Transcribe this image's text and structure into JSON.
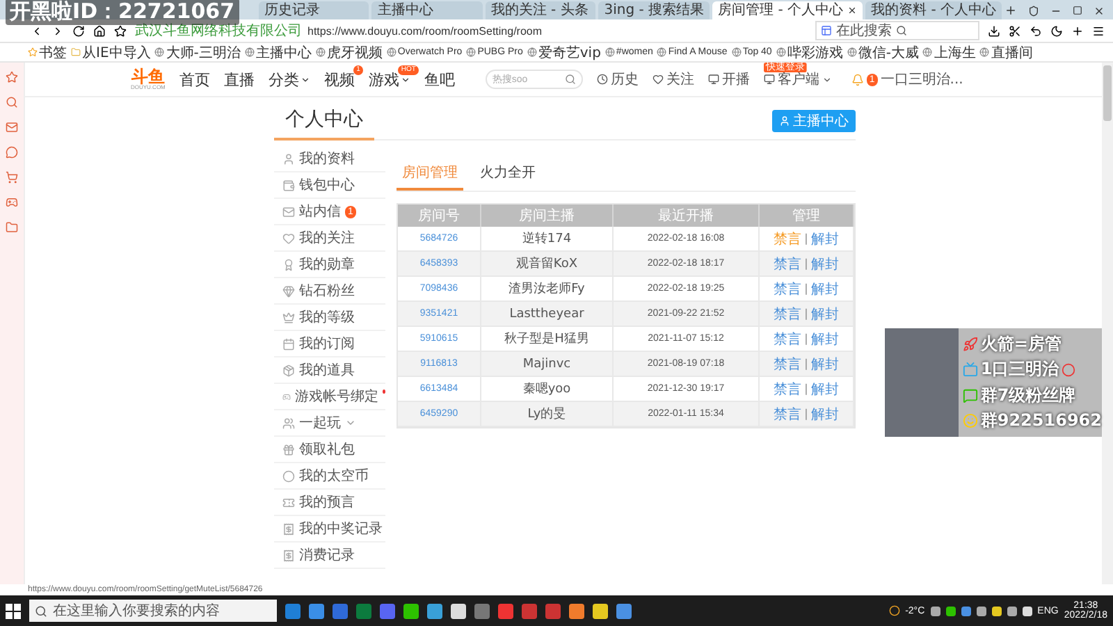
{
  "stream_overlay": {
    "caption": "开黑啦ID：22721067"
  },
  "browser": {
    "tabs": [
      {
        "title": "历史记录",
        "selected": false
      },
      {
        "title": "主播中心",
        "selected": false
      },
      {
        "title": "我的关注 - 头条",
        "selected": false
      },
      {
        "title": "3ing - 搜索结果",
        "selected": false
      },
      {
        "title": "房间管理 - 个人中心",
        "selected": true
      },
      {
        "title": "我的资料 - 个人中心",
        "selected": false
      }
    ],
    "address": {
      "cert": "武汉斗鱼网络科技有限公司",
      "url": "https://www.douyu.com/room/roomSetting/room"
    },
    "search": {
      "placeholder": "在此搜索"
    },
    "bookmarks": [
      "书签",
      "从IE中导入",
      "大师-三明治",
      "主播中心",
      "虎牙视频",
      "Overwatch Pro",
      "PUBG Pro",
      "爱奇艺vip",
      "#women",
      "Find A Mouse",
      "Top 40",
      "哔彩游戏",
      "微信-大威",
      "上海生",
      "直播间"
    ],
    "status_url": "https://www.douyu.com/room/roomSetting/getMuteList/5684726"
  },
  "site_header": {
    "logo": "斗鱼",
    "logo_sub": "DOUYU.COM",
    "nav": [
      {
        "label": "首页",
        "dropdown": false
      },
      {
        "label": "直播",
        "dropdown": false
      },
      {
        "label": "分类",
        "dropdown": true
      },
      {
        "label": "视频",
        "dropdown": false,
        "dot": "1"
      },
      {
        "label": "游戏",
        "dropdown": true,
        "tag": "HOT"
      },
      {
        "label": "鱼吧",
        "dropdown": false
      }
    ],
    "search": {
      "placeholder": "热搜soo"
    },
    "actions": [
      {
        "kind": "history",
        "label": "历史"
      },
      {
        "kind": "follow",
        "label": "关注"
      },
      {
        "kind": "live",
        "label": "开播"
      },
      {
        "kind": "client",
        "label": "客户端",
        "tag": "快速登录"
      }
    ],
    "user": {
      "name": "一口三明治...",
      "notifications": "1"
    }
  },
  "page": {
    "title": "个人中心",
    "anchor_button": "主播中心",
    "menu": [
      {
        "label": "我的资料",
        "kind": "link"
      },
      {
        "label": "钱包中心",
        "kind": "link"
      },
      {
        "label": "站内信",
        "kind": "link",
        "badge": "1"
      },
      {
        "label": "我的关注",
        "kind": "link"
      },
      {
        "label": "我的勋章",
        "kind": "link"
      },
      {
        "label": "钻石粉丝",
        "kind": "link"
      },
      {
        "label": "我的等级",
        "kind": "link"
      },
      {
        "label": "我的订阅",
        "kind": "link"
      },
      {
        "label": "我的道具",
        "kind": "link"
      },
      {
        "label": "游戏帐号绑定",
        "kind": "link",
        "dot": true
      },
      {
        "label": "一起玩",
        "kind": "group",
        "expanded": false
      },
      {
        "label": "领取礼包",
        "kind": "link"
      },
      {
        "label": "我的太空币",
        "kind": "link"
      },
      {
        "label": "我的预言",
        "kind": "link"
      },
      {
        "label": "我的中奖记录",
        "kind": "link"
      },
      {
        "label": "消费记录",
        "kind": "link"
      }
    ],
    "tabs": [
      {
        "label": "房间管理",
        "selected": true
      },
      {
        "label": "火力全开",
        "selected": false
      }
    ],
    "table": {
      "columns": [
        "房间号",
        "房间主播",
        "最近开播",
        "管理"
      ],
      "separator": "|",
      "rows": [
        {
          "room": "5684726",
          "anchor": "逆转174",
          "last_live": "2022-02-18 16:08",
          "actions": [
            {
              "label": "禁言",
              "hovered": true
            },
            {
              "label": "解封",
              "hovered": false
            }
          ]
        },
        {
          "room": "6458393",
          "anchor": "观音留KoX",
          "last_live": "2022-02-18 18:17",
          "actions": [
            {
              "label": "禁言",
              "hovered": false
            },
            {
              "label": "解封",
              "hovered": false
            }
          ]
        },
        {
          "room": "7098436",
          "anchor": "渣男汝老师Fy",
          "last_live": "2022-02-18 19:25",
          "actions": [
            {
              "label": "禁言",
              "hovered": false
            },
            {
              "label": "解封",
              "hovered": false
            }
          ]
        },
        {
          "room": "9351421",
          "anchor": "Lasttheyear",
          "last_live": "2021-09-22 21:52",
          "actions": [
            {
              "label": "禁言",
              "hovered": false
            },
            {
              "label": "解封",
              "hovered": false
            }
          ]
        },
        {
          "room": "5910615",
          "anchor": "秋子型是H猛男",
          "last_live": "2021-11-07 15:12",
          "actions": [
            {
              "label": "禁言",
              "hovered": false
            },
            {
              "label": "解封",
              "hovered": false
            }
          ]
        },
        {
          "room": "9116813",
          "anchor": "Majinvc",
          "last_live": "2021-08-19 07:18",
          "actions": [
            {
              "label": "禁言",
              "hovered": false
            },
            {
              "label": "解封",
              "hovered": false
            }
          ]
        },
        {
          "room": "6613484",
          "anchor": "秦嗯yoo",
          "last_live": "2021-12-30 19:17",
          "actions": [
            {
              "label": "禁言",
              "hovered": false
            },
            {
              "label": "解封",
              "hovered": false
            }
          ]
        },
        {
          "room": "6459290",
          "anchor": "Ly的旻",
          "last_live": "2022-01-11 15:34",
          "actions": [
            {
              "label": "禁言",
              "hovered": false
            },
            {
              "label": "解封",
              "hovered": false
            }
          ]
        }
      ]
    }
  },
  "webcam_card": {
    "lines": [
      {
        "kind": "rocket",
        "text": "火箭=房管"
      },
      {
        "kind": "bilibili",
        "text": "1口三明治",
        "trailing_logo": true
      },
      {
        "kind": "wechat",
        "text": "群7级粉丝牌"
      },
      {
        "kind": "qq",
        "text": "群922516962"
      }
    ]
  },
  "taskbar": {
    "search_placeholder": "在这里输入你要搜索的内容",
    "weather": "-2°C",
    "language": "ENG",
    "time": "21:38",
    "date": "2022/2/18"
  }
}
